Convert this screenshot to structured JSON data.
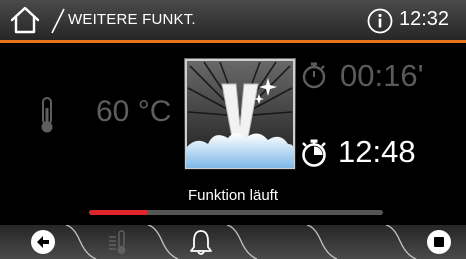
{
  "header": {
    "title": "WEITERE FUNKT.",
    "time": "12:32",
    "home_icon": "home-icon",
    "info_icon": "info-icon"
  },
  "main": {
    "temperature": "60 °C",
    "thermometer_icon": "thermometer-icon",
    "program_icon": "v-program-icon",
    "duration_icon": "stopwatch-icon",
    "duration": "00:16'",
    "endtime_icon": "end-time-stopwatch-icon",
    "end_time": "12:48",
    "status": "Funktion läuft",
    "progress": 0.2
  },
  "bottom_bar": {
    "buttons": [
      "back-icon",
      "heat-icon",
      "bell-icon",
      "stop-icon"
    ]
  },
  "colors": {
    "accent": "#e8731c",
    "progress": "#e0262c",
    "dim_text": "#5e5e5e"
  }
}
